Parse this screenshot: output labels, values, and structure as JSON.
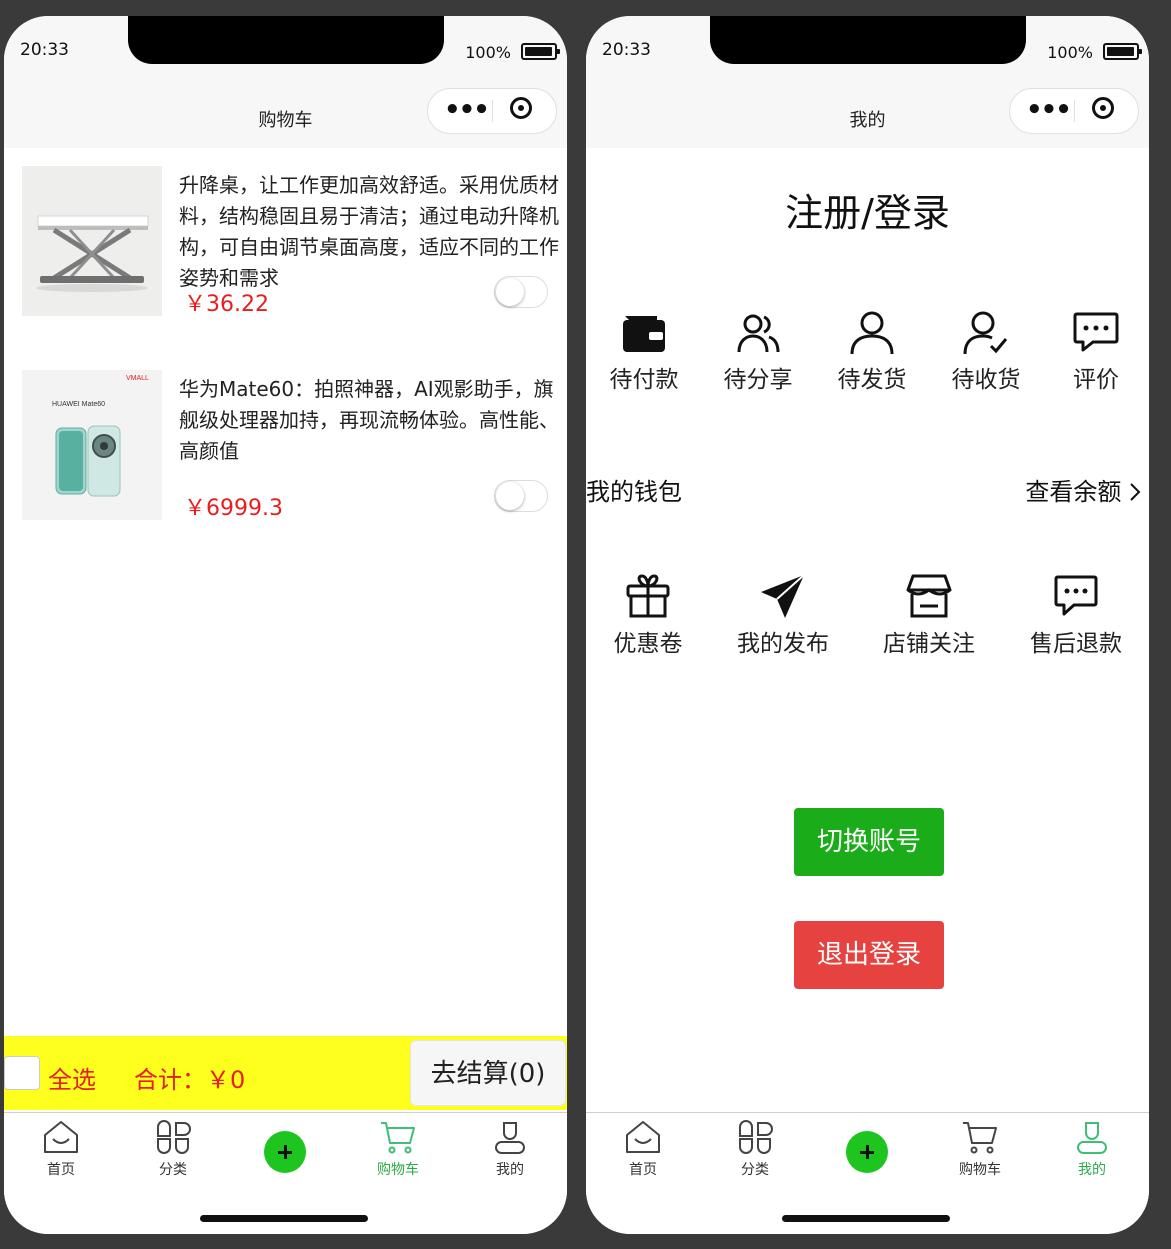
{
  "left": {
    "status": {
      "time": "20:33",
      "battery": "100%"
    },
    "nav_title": "购物车",
    "items": [
      {
        "desc": "升降桌，让工作更加高效舒适。采用优质材料，结构稳固且易于清洁；通过电动升降机构，可自由调节桌面高度，适应不同的工作姿势和需求",
        "price": "￥36.22",
        "image": "standing-desk",
        "selected": false
      },
      {
        "desc": "华为Mate60：拍照神器，AI观影助手，旗舰级处理器加持，再现流畅体验。高性能、高颜值",
        "price": "￥6999.3",
        "image": "huawei-mate60",
        "selected": false
      }
    ],
    "phone_ad": {
      "brand": "VMALL",
      "model": "HUAWEI Mate60"
    },
    "checkout": {
      "select_all": "全选",
      "total": "合计：￥0",
      "button": "去结算(0)"
    },
    "tabs": [
      {
        "label": "首页",
        "icon": "home-icon"
      },
      {
        "label": "分类",
        "icon": "category-icon"
      },
      {
        "label": "",
        "icon": "add-icon"
      },
      {
        "label": "购物车",
        "icon": "cart-icon"
      },
      {
        "label": "我的",
        "icon": "user-icon"
      }
    ],
    "active_tab": "购物车"
  },
  "right": {
    "status": {
      "time": "20:33",
      "battery": "100%"
    },
    "nav_title": "我的",
    "login": "注册/登录",
    "orders": [
      {
        "label": "待付款",
        "icon": "wallet-icon"
      },
      {
        "label": "待分享",
        "icon": "share-users-icon"
      },
      {
        "label": "待发货",
        "icon": "person-icon"
      },
      {
        "label": "待收货",
        "icon": "person-check-icon"
      },
      {
        "label": "评价",
        "icon": "comment-icon"
      }
    ],
    "wallet": {
      "label": "我的钱包",
      "link": "查看余额"
    },
    "services": [
      {
        "label": "优惠卷",
        "icon": "gift-icon"
      },
      {
        "label": "我的发布",
        "icon": "send-icon"
      },
      {
        "label": "店铺关注",
        "icon": "store-icon"
      },
      {
        "label": "售后退款",
        "icon": "chat-icon"
      }
    ],
    "buttons": {
      "switch_account": "切换账号",
      "logout": "退出登录"
    },
    "tabs": [
      {
        "label": "首页",
        "icon": "home-icon"
      },
      {
        "label": "分类",
        "icon": "category-icon"
      },
      {
        "label": "",
        "icon": "add-icon"
      },
      {
        "label": "购物车",
        "icon": "cart-icon"
      },
      {
        "label": "我的",
        "icon": "user-icon"
      }
    ],
    "active_tab": "我的"
  },
  "colors": {
    "accent_green": "#1aad19",
    "tab_active": "#2eaa4a",
    "price_red": "#e81e1e",
    "logout_red": "#e64340",
    "checkout_yellow": "#ffff1e"
  }
}
